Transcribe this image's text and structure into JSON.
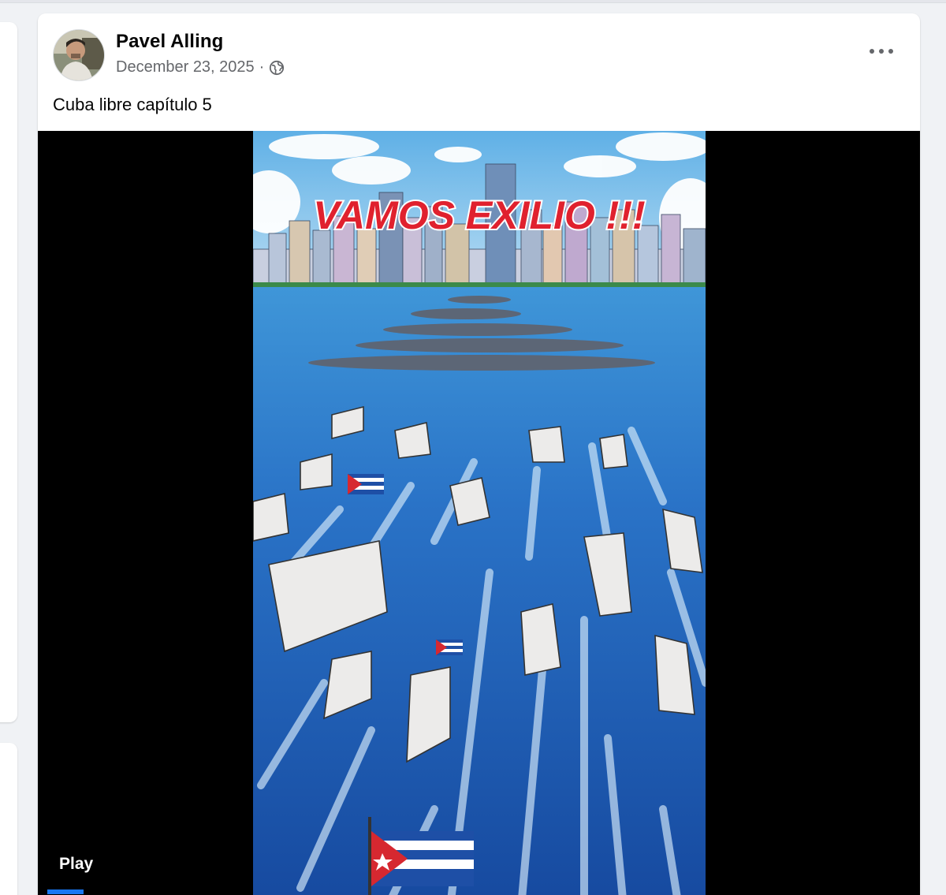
{
  "post": {
    "author": "Pavel Alling",
    "date": "December 23, 2025",
    "separator": "·",
    "audience_icon": "globe-icon",
    "caption": "Cuba libre capítulo 5",
    "more_icon": "more-options-icon"
  },
  "video": {
    "overlay_title": "VAMOS EXILIO !!!",
    "play_label": "Play"
  },
  "colors": {
    "link_blue": "#1877f2",
    "secondary_text": "#65676b",
    "title_red": "#e0212e",
    "sea": "#1d5fb8",
    "sky": "#7fc1ea"
  }
}
